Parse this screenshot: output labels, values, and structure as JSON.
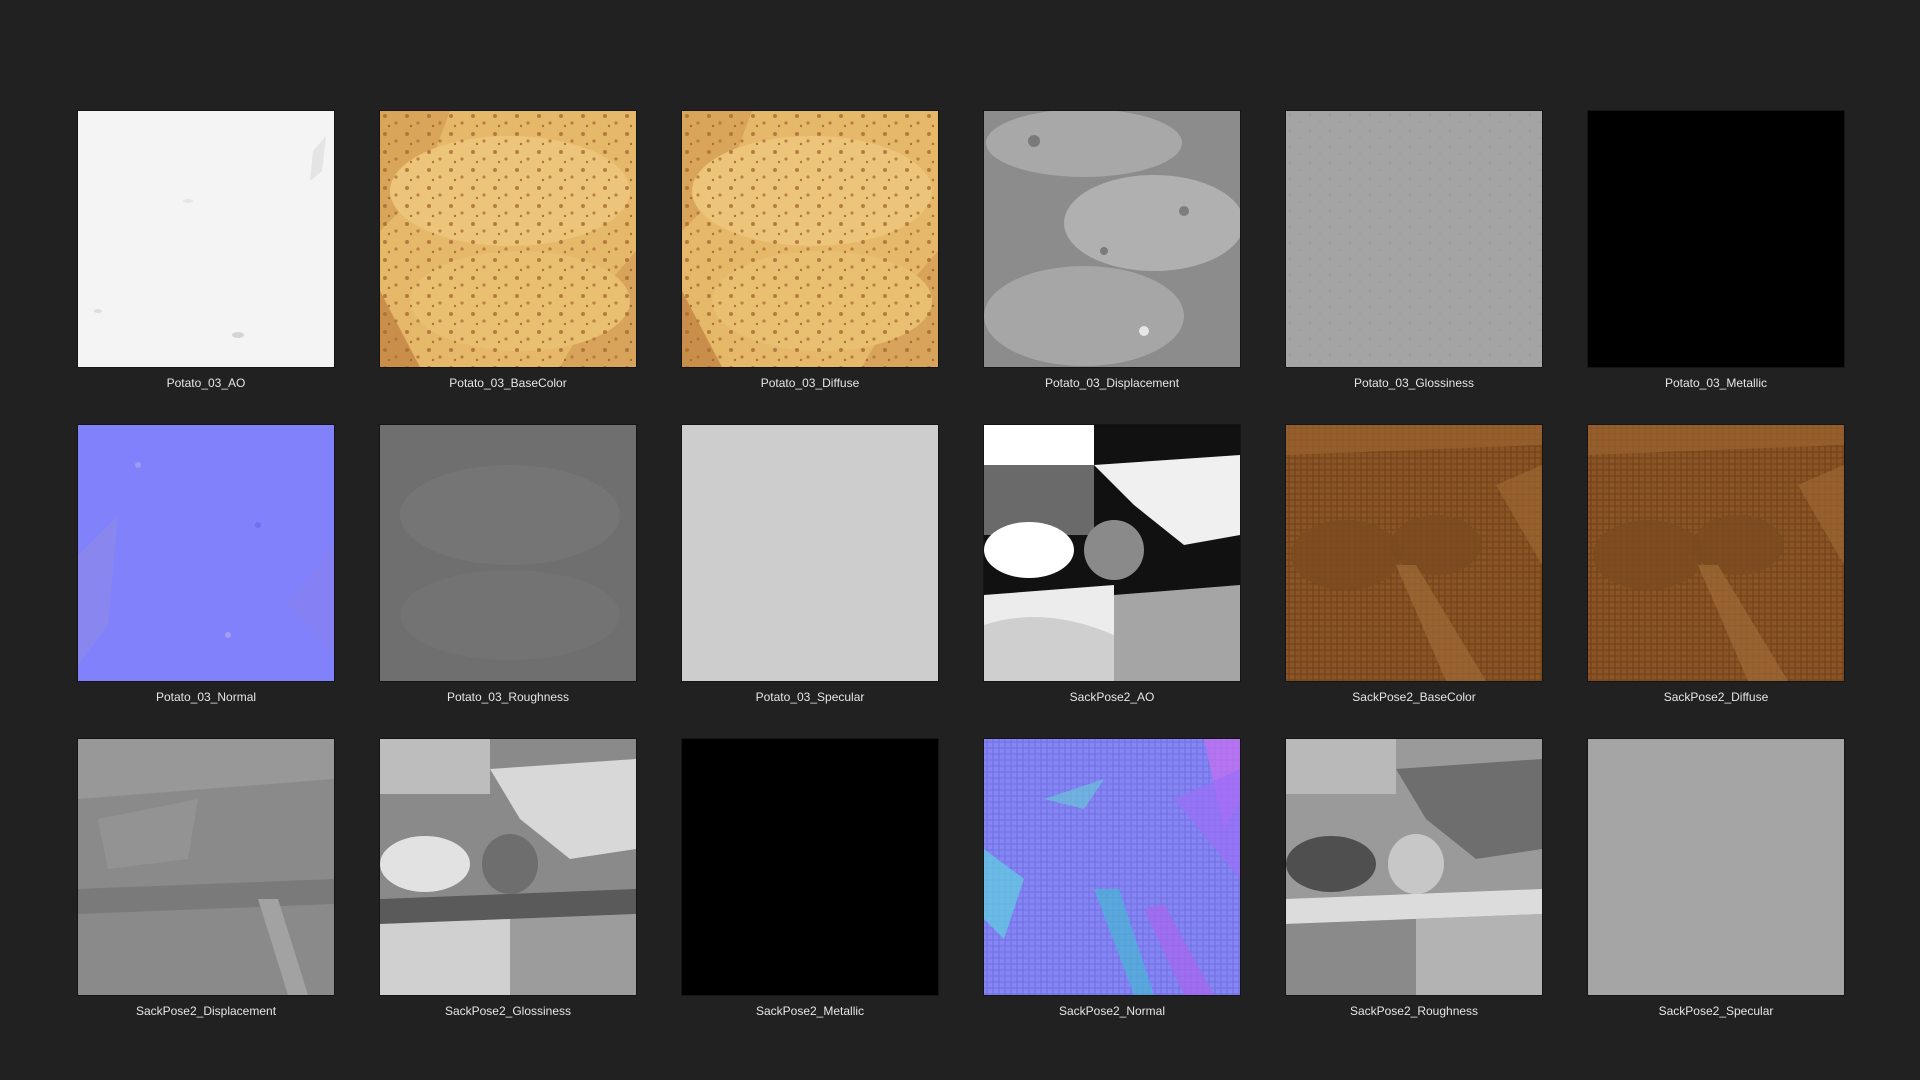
{
  "gallery": {
    "items": [
      {
        "label": "Potato_03_AO",
        "icon": "texture-ao-thumbnail",
        "color": "#f3f3f3"
      },
      {
        "label": "Potato_03_BaseColor",
        "icon": "texture-basecolor-thumbnail",
        "color": "#e2b668"
      },
      {
        "label": "Potato_03_Diffuse",
        "icon": "texture-diffuse-thumbnail",
        "color": "#e2b668"
      },
      {
        "label": "Potato_03_Displacement",
        "icon": "texture-displacement-thumbnail",
        "color": "#8e8e8e"
      },
      {
        "label": "Potato_03_Glossiness",
        "icon": "texture-glossiness-thumbnail",
        "color": "#a3a3a3"
      },
      {
        "label": "Potato_03_Metallic",
        "icon": "texture-metallic-thumbnail",
        "color": "#000000"
      },
      {
        "label": "Potato_03_Normal",
        "icon": "texture-normal-thumbnail",
        "color": "#7f80fb"
      },
      {
        "label": "Potato_03_Roughness",
        "icon": "texture-roughness-thumbnail",
        "color": "#707070"
      },
      {
        "label": "Potato_03_Specular",
        "icon": "texture-specular-thumbnail",
        "color": "#cdcdcd"
      },
      {
        "label": "SackPose2_AO",
        "icon": "texture-ao-thumbnail",
        "color": "#ffffff"
      },
      {
        "label": "SackPose2_BaseColor",
        "icon": "texture-basecolor-thumbnail",
        "color": "#8a5424"
      },
      {
        "label": "SackPose2_Diffuse",
        "icon": "texture-diffuse-thumbnail",
        "color": "#8a5424"
      },
      {
        "label": "SackPose2_Displacement",
        "icon": "texture-displacement-thumbnail",
        "color": "#8a8a8a"
      },
      {
        "label": "SackPose2_Glossiness",
        "icon": "texture-glossiness-thumbnail",
        "color": "#9a9a9a"
      },
      {
        "label": "SackPose2_Metallic",
        "icon": "texture-metallic-thumbnail",
        "color": "#000000"
      },
      {
        "label": "SackPose2_Normal",
        "icon": "texture-normal-thumbnail",
        "color": "#8585f5"
      },
      {
        "label": "SackPose2_Roughness",
        "icon": "texture-roughness-thumbnail",
        "color": "#8c8c8c"
      },
      {
        "label": "SackPose2_Specular",
        "icon": "texture-specular-thumbnail",
        "color": "#a5a5a5"
      }
    ]
  }
}
